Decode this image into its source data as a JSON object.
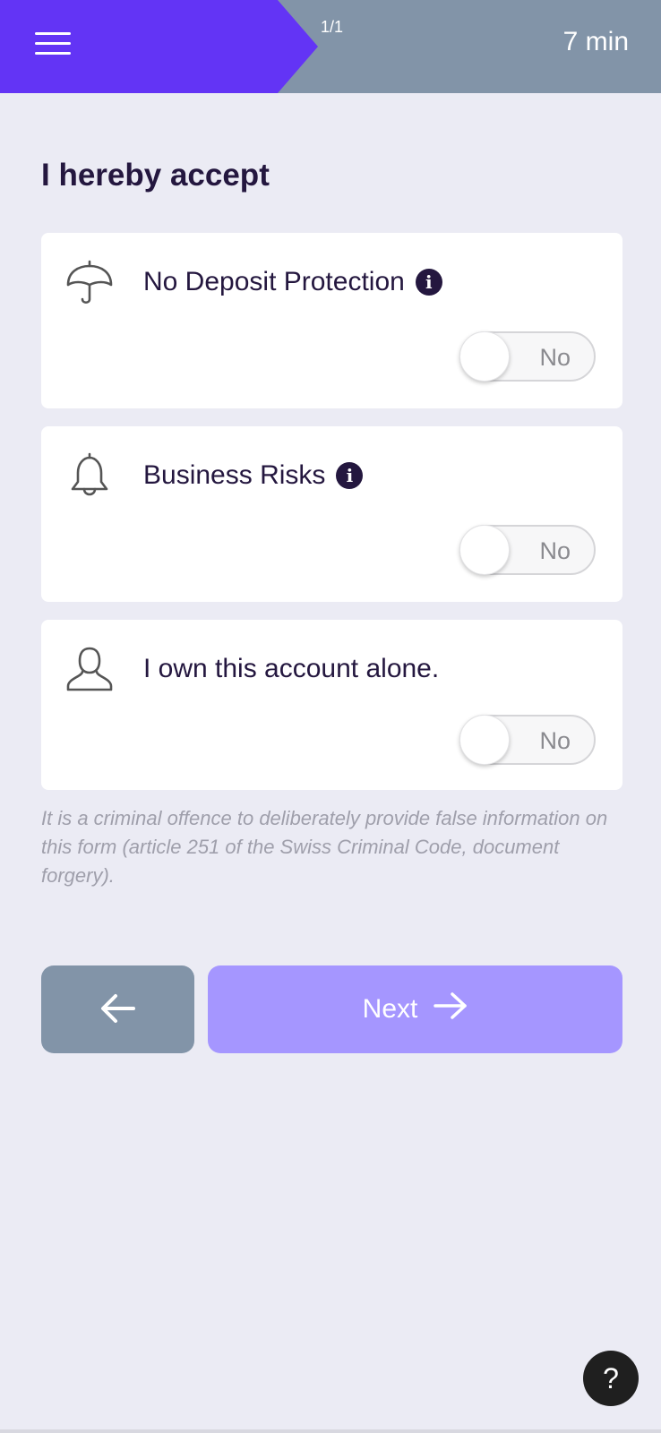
{
  "header": {
    "step_counter": "1/1",
    "time_remaining": "7 min",
    "menu_icon": "hamburger-menu-icon"
  },
  "page": {
    "title": "I hereby accept"
  },
  "items": [
    {
      "label": "No Deposit Protection",
      "icon": "umbrella-icon",
      "has_info": true,
      "toggle_value": "No",
      "toggle_on": false
    },
    {
      "label": "Business Risks",
      "icon": "bell-icon",
      "has_info": true,
      "toggle_value": "No",
      "toggle_on": false
    },
    {
      "label": "I own this account alone.",
      "icon": "person-icon",
      "has_info": false,
      "toggle_value": "No",
      "toggle_on": false
    }
  ],
  "disclaimer": "It is a criminal offence to deliberately provide false information on this form (article 251 of the Swiss Criminal Code, document forgery).",
  "navigation": {
    "back_icon": "arrow-left-icon",
    "next_label": "Next",
    "next_icon": "arrow-right-icon"
  },
  "help": {
    "label": "?"
  },
  "colors": {
    "brand_purple": "#6334f5",
    "header_gray": "#8294a8",
    "next_button": "#a596ff",
    "background": "#ebebf4",
    "text_dark": "#24173f"
  }
}
